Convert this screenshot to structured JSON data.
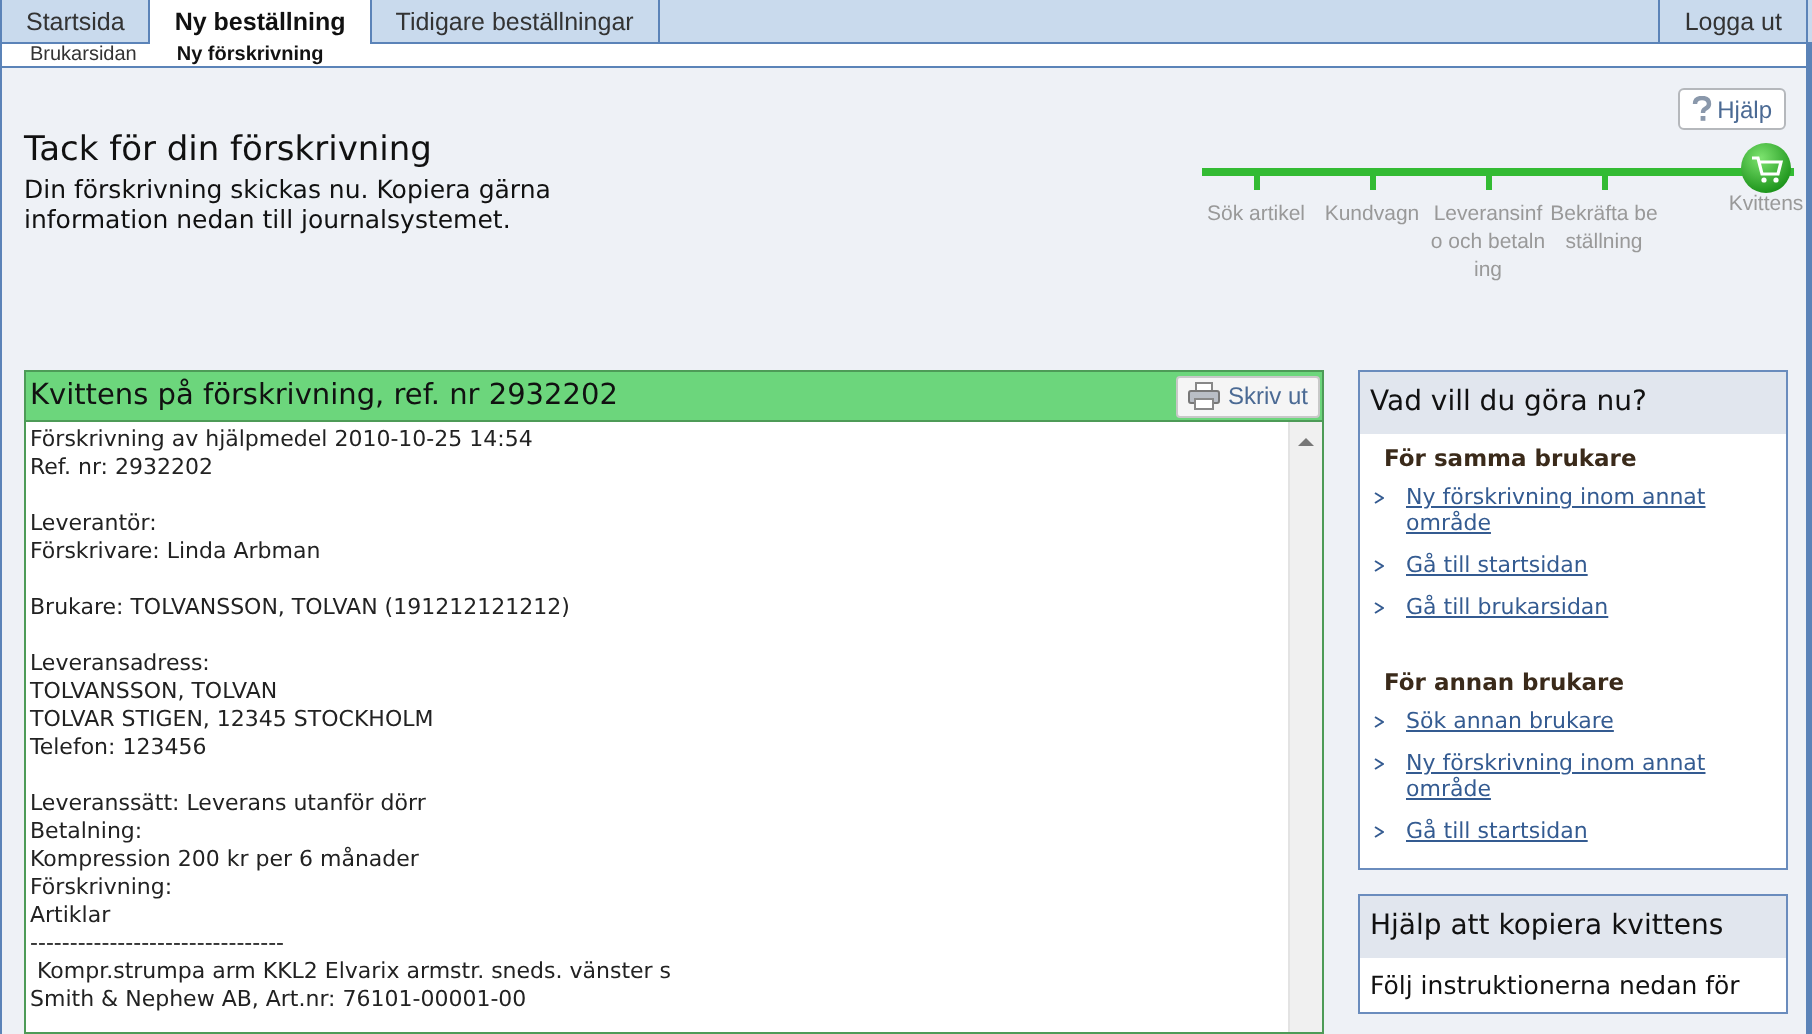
{
  "tabs": [
    {
      "label": "Startsida",
      "selected": false
    },
    {
      "label": "Ny beställning",
      "selected": true
    },
    {
      "label": "Tidigare beställningar",
      "selected": false
    }
  ],
  "logout": "Logga ut",
  "subnav": [
    {
      "label": "Brukarsidan",
      "selected": false
    },
    {
      "label": "Ny förskrivning",
      "selected": true
    }
  ],
  "help_button": "Hjälp",
  "title": "Tack för din förskrivning",
  "intro": "Din förskrivning skickas nu. Kopiera gärna information nedan till journalsystemet.",
  "steps": [
    {
      "label": "Sök artikel",
      "selected": false
    },
    {
      "label": "Kundvagn",
      "selected": false
    },
    {
      "label": "Leveransinfo och betalning",
      "selected": false
    },
    {
      "label": "Bekräfta beställning",
      "selected": false
    },
    {
      "label": "Kvittens",
      "selected": true
    }
  ],
  "receipt": {
    "title": "Kvittens på förskrivning, ref. nr 2932202",
    "print_button": "Skriv ut",
    "blocks": [
      [
        "Förskrivning av hjälpmedel 2010-10-25 14:54",
        "Ref. nr: 2932202"
      ],
      [
        "Leverantör:",
        "Förskrivare: Linda Arbman"
      ],
      [
        "Brukare: TOLVANSSON, TOLVAN (191212121212)"
      ],
      [
        "Leveransadress:",
        "TOLVANSSON, TOLVAN",
        "TOLVAR STIGEN, 12345 STOCKHOLM",
        "Telefon: 123456"
      ],
      [
        "Leveranssätt: Leverans utanför dörr",
        "Betalning:",
        "Kompression 200 kr per 6 månader",
        "Förskrivning:",
        "Artiklar",
        "--------------------------------",
        " Kompr.strumpa arm KKL2 Elvarix armstr. sneds. vänster s",
        "Smith & Nephew AB, Art.nr: 76101-00001-00"
      ]
    ]
  },
  "actions": {
    "title": "Vad vill du göra nu?",
    "groups": [
      {
        "heading": "För samma brukare",
        "links": [
          "Ny förskrivning inom annat område",
          "Gå till startsidan",
          "Gå till brukarsidan"
        ]
      },
      {
        "heading": "För annan brukare",
        "links": [
          "Sök annan brukare",
          "Ny förskrivning inom annat område",
          "Gå till startsidan"
        ]
      }
    ]
  },
  "copy_help": {
    "title": "Hjälp att kopiera kvittens",
    "text": "Följ instruktionerna nedan för"
  }
}
